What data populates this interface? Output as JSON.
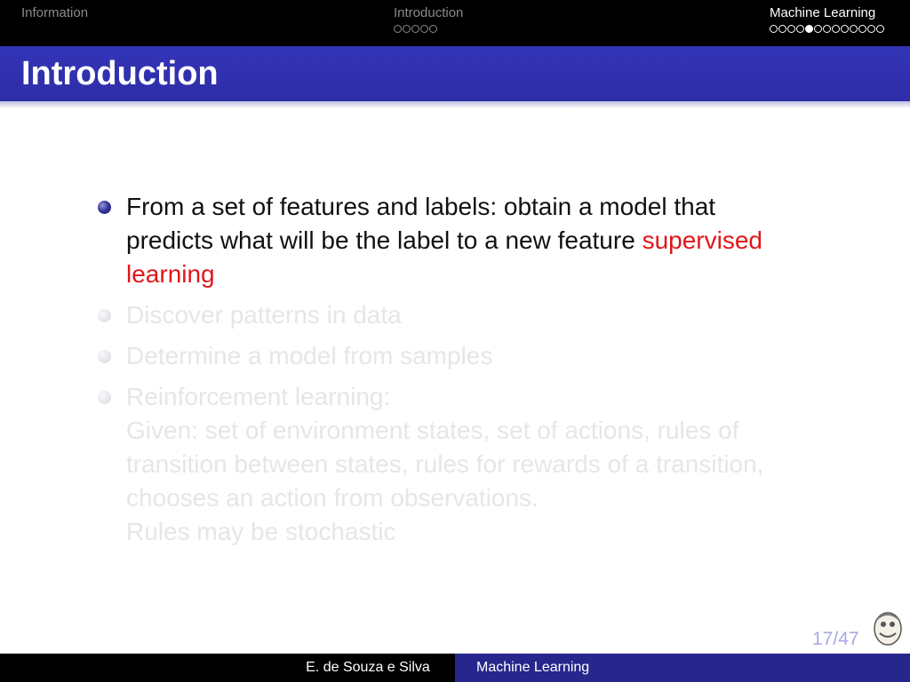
{
  "headline": {
    "sections": [
      {
        "label": "Information",
        "active": false,
        "dots": 0,
        "current_dot": -1
      },
      {
        "label": "Introduction",
        "active": false,
        "dots": 5,
        "current_dot": -1
      },
      {
        "label": "Machine Learning",
        "active": true,
        "dots": 13,
        "current_dot": 4
      }
    ]
  },
  "frame": {
    "title": "Introduction"
  },
  "items": {
    "item1_line1": "From a set of features and labels: obtain a model that",
    "item1_line2": "predicts what will be the label to a new feature",
    "item1_hl_a": "supervised",
    "item1_hl_b": "learning",
    "item2": "Discover patterns in data",
    "item3": "Determine a model from samples",
    "item4_line1": "Reinforcement learning:",
    "item4_line2": "Given: set of environment states, set of actions, rules of",
    "item4_line3": "transition between states, rules for rewards of a transition,",
    "item4_line4": "chooses an action from observations.",
    "item4_line5": "Rules may be stochastic"
  },
  "page": {
    "number": "17/47"
  },
  "footer": {
    "author": "E. de Souza e Silva",
    "title": "Machine Learning"
  },
  "colors": {
    "headline_bg": "#000000",
    "frametitle_bg": "#3333b2",
    "highlight": "#e0161a",
    "footer_title_bg": "#26268c",
    "dimmed_text": "#e6e6e6"
  }
}
